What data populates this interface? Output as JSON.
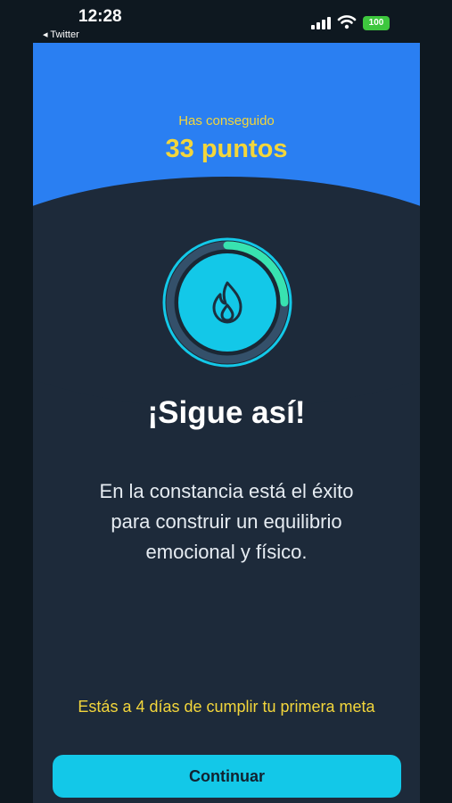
{
  "status_bar": {
    "time": "12:28",
    "back_label": "◂ Twitter",
    "battery": "100"
  },
  "summary": {
    "caption": "Has conseguido",
    "points": "33 puntos",
    "ring_progress_percent": 25
  },
  "headline": "¡Sigue así!",
  "message_lines": [
    "En la constancia está el éxito",
    "para construir un equilibrio",
    "emocional y físico."
  ],
  "goal_note": "Estás a 4 días de cumplir tu primera meta",
  "continue_label": "Continuar",
  "colors": {
    "header_blue": "#2a7ff2",
    "panel": "#1d2a3a",
    "accent_yellow": "#f3d63b",
    "accent_cyan": "#13c8e8",
    "ring_green": "#38e3b0"
  },
  "icons": {
    "ring_center": "flame-icon"
  }
}
